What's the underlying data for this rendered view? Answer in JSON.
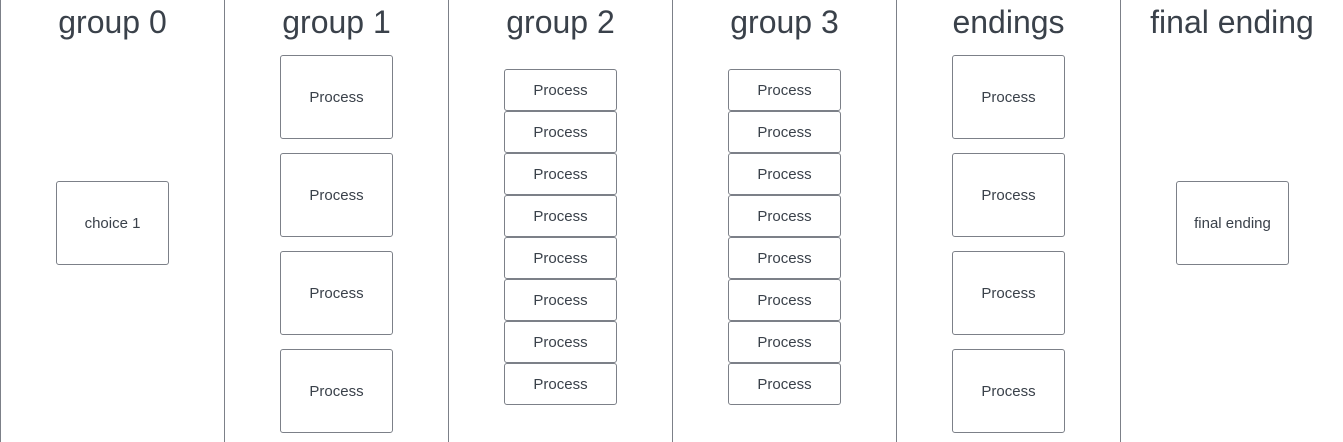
{
  "lanes": [
    {
      "title": "group 0",
      "nodes": [
        "choice 1"
      ]
    },
    {
      "title": "group 1",
      "nodes": [
        "Process",
        "Process",
        "Process",
        "Process"
      ]
    },
    {
      "title": "group 2",
      "nodes": [
        "Process",
        "Process",
        "Process",
        "Process",
        "Process",
        "Process",
        "Process",
        "Process"
      ]
    },
    {
      "title": "group 3",
      "nodes": [
        "Process",
        "Process",
        "Process",
        "Process",
        "Process",
        "Process",
        "Process",
        "Process"
      ]
    },
    {
      "title": "endings",
      "nodes": [
        "Process",
        "Process",
        "Process",
        "Process"
      ]
    },
    {
      "title": "final ending",
      "nodes": [
        "final ending"
      ]
    }
  ]
}
